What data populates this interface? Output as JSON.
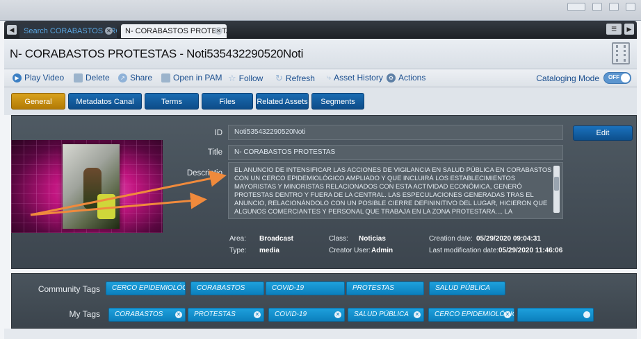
{
  "tabs": [
    {
      "label": "Search CORABASTOS PROT..."
    },
    {
      "label": "N- CORABASTOS PROTESTA..."
    }
  ],
  "title": "N- CORABASTOS PROTESTAS - Noti535432290520Noti",
  "toolbar": {
    "play": "Play Video",
    "delete": "Delete",
    "share": "Share",
    "open": "Open in PAM",
    "follow": "Follow",
    "refresh": "Refresh",
    "history": "Asset History",
    "actions": "Actions",
    "cataloging": "Cataloging Mode",
    "toggle": "OFF"
  },
  "navtabs": [
    "General",
    "Metadatos Canal Capital",
    "Terms",
    "Files",
    "Related Assets",
    "Segments"
  ],
  "fields": {
    "id_label": "ID",
    "id_value": "Noti535432290520Noti",
    "title_label": "Title",
    "title_value": "N- CORABASTOS PROTESTAS",
    "desc_label": "Descriptio",
    "desc_value": "EL ANUNCIO DE INTENSIFICAR LAS ACCIONES DE VIGILANCIA EN SALUD PÚBLICA EN CORABASTOS CON UN CERCO EPIDEMIOLÓGICO AMPLIADO Y QUE INCLUIRÁ LOS ESTABLECIMIENTOS MAYORISTAS Y MINORISTAS RELACIONADOS CON ESTA ACTIVIDAD ECONÓMICA, GENERÓ PROTESTAS DENTRO Y FUERA DE LA CENTRAL. LAS ESPECULACIONES GENERADAS TRAS EL ANUNCIO, RELACIONÁNDOLO CON UN POSIBLE CIERRE DEFININITIVO DEL LUGAR, HICIERON QUE ALGUNOS COMERCIANTES Y PERSONAL QUE TRABAJA EN LA ZONA PROTESTARA.... LA",
    "edit": "Edit"
  },
  "meta": {
    "area_label": "Area:",
    "area_value": "Broadcast",
    "type_label": "Type:",
    "type_value": "media",
    "class_label": "Class:",
    "class_value": "Noticias",
    "creator_label": "Creator User:",
    "creator_value": "Admin",
    "created_label": "Creation date:",
    "created_value": "05/29/2020 09:04:31",
    "modified_label": "Last modification date:",
    "modified_value": "05/29/2020 11:46:06"
  },
  "community_tags_label": "Community Tags",
  "community_tags": [
    "CERCO EPIDEMIOLÓGICO",
    "CORABASTOS",
    "COVID-19",
    "PROTESTAS",
    "SALUD PÚBLICA"
  ],
  "my_tags_label": "My Tags",
  "my_tags": [
    "CORABASTOS",
    "PROTESTAS",
    "COVID-19",
    "SALUD PÚBLICA",
    "CERCO EPIDEMIOLÓGICO"
  ],
  "colors": {
    "accent": "#0f5fa3",
    "active_tab": "#c48d10",
    "tag": "#1592cf",
    "arrow": "#f08a3c"
  }
}
